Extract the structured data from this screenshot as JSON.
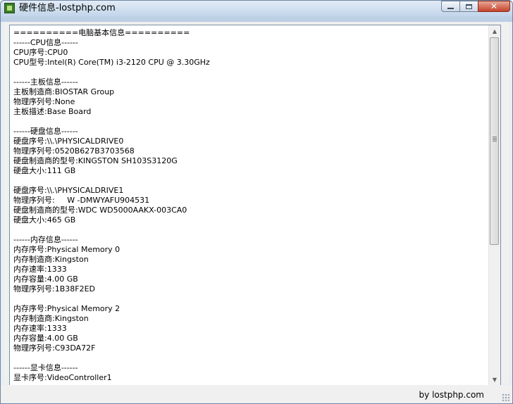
{
  "window": {
    "title": "硬件信息-lostphp.com",
    "controls": {
      "minimize": "",
      "maximize": "",
      "close": "✕"
    }
  },
  "info_lines": [
    "==========电脑基本信息==========",
    "------CPU信息------",
    "CPU序号:CPU0",
    "CPU型号:Intel(R) Core(TM) i3-2120 CPU @ 3.30GHz",
    "",
    "------主板信息------",
    "主板制造商:BIOSTAR Group",
    "物理序列号:None",
    "主板描述:Base Board",
    "",
    "------硬盘信息------",
    "硬盘序号:\\\\.\\PHYSICALDRIVE0",
    "物理序列号:0520B627B3703568",
    "硬盘制造商的型号:KINGSTON SH103S3120G",
    "硬盘大小:111 GB",
    "",
    "硬盘序号:\\\\.\\PHYSICALDRIVE1",
    "物理序列号:     W -DMWYAFU904531",
    "硬盘制造商的型号:WDC WD5000AAKX-003CA0",
    "硬盘大小:465 GB",
    "",
    "------内存信息------",
    "内存序号:Physical Memory 0",
    "内存制造商:Kingston",
    "内存速率:1333",
    "内存容量:4.00 GB",
    "物理序列号:1B38F2ED",
    "",
    "内存序号:Physical Memory 2",
    "内存制造商:Kingston",
    "内存速率:1333",
    "内存容量:4.00 GB",
    "物理序列号:C93DA72F",
    "",
    "------显卡信息------",
    "显卡序号:VideoController1"
  ],
  "statusbar": {
    "text": "by lostphp.com"
  },
  "icons": {
    "app": "app-icon",
    "scroll_up": "▲",
    "scroll_down": "▼"
  }
}
